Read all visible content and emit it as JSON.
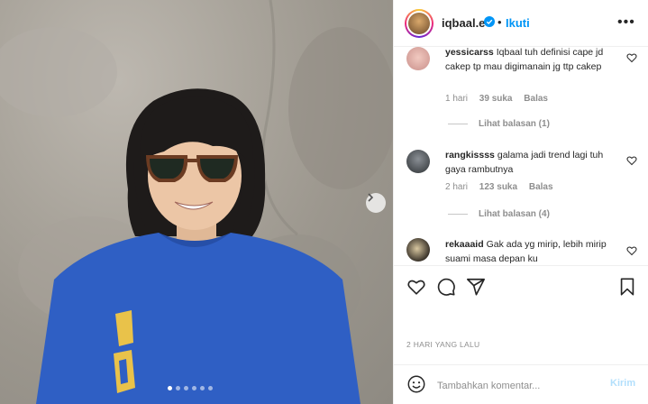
{
  "post": {
    "username": "iqbaal.e",
    "follow_label": "Ikuti",
    "separator": "•",
    "carousel_count": 6,
    "carousel_active_index": 0
  },
  "comments": [
    {
      "username": "yessicarss",
      "text": "Iqbaal tuh definisi cape jd cakep tp mau digimanain jg ttp cakep",
      "time": "1 hari",
      "likes": "39 suka",
      "reply_label": "Balas",
      "view_replies": "Lihat balasan (1)"
    },
    {
      "username": "rangkissss",
      "text": "galama jadi trend lagi tuh gaya rambutnya",
      "time": "2 hari",
      "likes": "123 suka",
      "reply_label": "Balas",
      "view_replies": "Lihat balasan (4)"
    },
    {
      "username": "rekaaaid",
      "text": "Gak ada yg mirip, lebih mirip suami masa depan ku",
      "time": "",
      "likes": "",
      "reply_label": "",
      "view_replies": ""
    }
  ],
  "footer": {
    "timestamp": "2 HARI YANG LALU",
    "comment_placeholder": "Tambahkan komentar...",
    "send_label": "Kirim"
  },
  "icons": {
    "next": "chevron-right-icon",
    "like": "heart-icon",
    "comment": "comment-icon",
    "share": "send-icon",
    "save": "bookmark-icon",
    "emoji": "emoji-icon",
    "more": "more-icon",
    "verified": "verified-badge-icon"
  },
  "colors": {
    "accent": "#0095f6",
    "send_disabled": "#b2dffc",
    "shirt": "#2f5fc4"
  }
}
